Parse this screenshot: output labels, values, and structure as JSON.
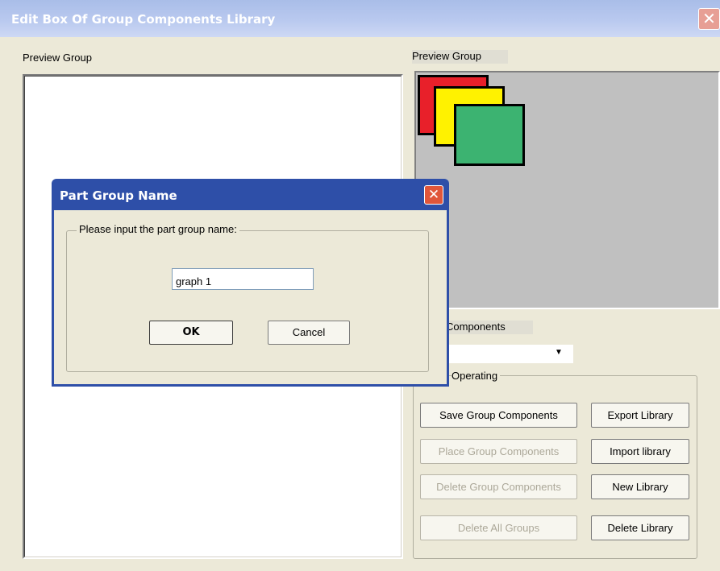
{
  "window": {
    "title": "Edit Box Of Group Components Library",
    "close_glyph": "✕"
  },
  "left_panel": {
    "label": "Preview Group"
  },
  "right_panel": {
    "label": "Preview Group",
    "shapes": [
      {
        "color": "#e8202a"
      },
      {
        "color": "#fff200"
      },
      {
        "color": "#3cb371"
      }
    ]
  },
  "components": {
    "label": "Components",
    "selected_value": "",
    "arrow": "▼"
  },
  "operating": {
    "legend": "Operating",
    "buttons": {
      "save_group": "Save Group Components",
      "place_group": "Place Group Components",
      "delete_group": "Delete Group Components",
      "delete_all": "Delete All Groups",
      "export_library": "Export Library",
      "import_library": "Import library",
      "new_library": "New Library",
      "delete_library": "Delete Library"
    }
  },
  "dialog": {
    "title": "Part Group Name",
    "close_glyph": "✕",
    "group_label": "Please input the part group name:",
    "input_value": "graph 1",
    "ok_label": "OK",
    "cancel_label": "Cancel"
  }
}
